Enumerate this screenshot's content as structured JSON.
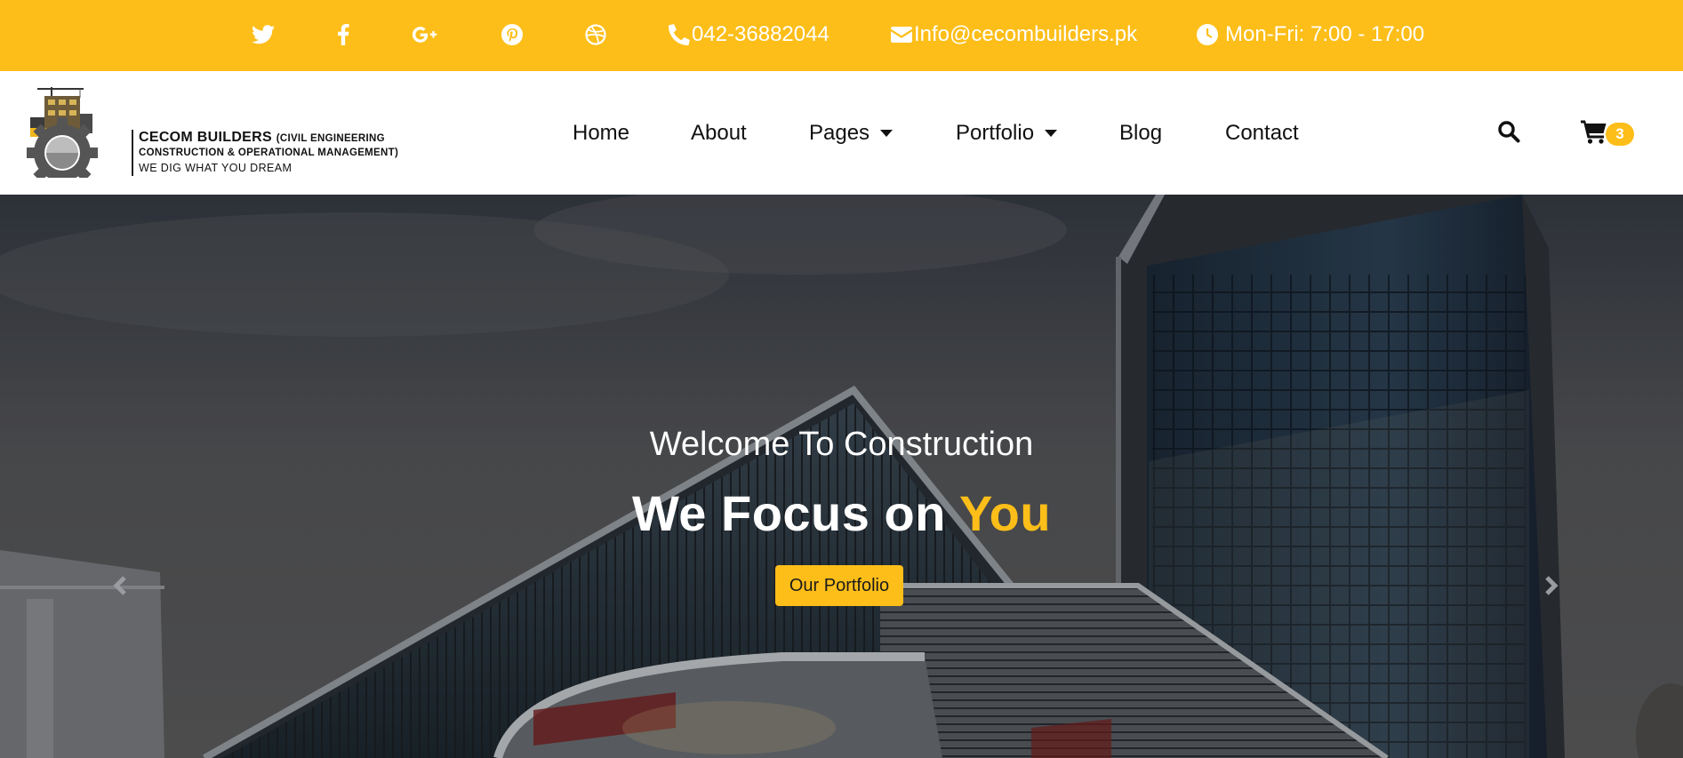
{
  "topbar": {
    "bg_color": "#fdbe19",
    "social": [
      {
        "icon": "twitter-icon"
      },
      {
        "icon": "facebook-icon"
      },
      {
        "icon": "google-plus-icon"
      },
      {
        "icon": "pinterest-icon"
      },
      {
        "icon": "dribbble-icon"
      }
    ],
    "phone": "042-36882044",
    "email": "Info@cecombuilders.pk",
    "hours": "Mon-Fri: 7:00 - 17:00"
  },
  "logo": {
    "name": "CECOM BUILDERS",
    "name_suffix": "(CIVIL ENGINEERING",
    "line2": "CONSTRUCTION & OPERATIONAL MANAGEMENT)",
    "tagline": "WE DIG WHAT YOU DREAM"
  },
  "nav": {
    "items": [
      {
        "label": "Home"
      },
      {
        "label": "About"
      },
      {
        "label": "Pages"
      },
      {
        "label": "Portfolio"
      },
      {
        "label": "Blog"
      },
      {
        "label": "Contact"
      }
    ],
    "cart_count": "3"
  },
  "hero": {
    "subtitle": "Welcome To Construction",
    "title_main": "We Focus on ",
    "title_accent": "You",
    "button_label": "Our Portfolio"
  }
}
